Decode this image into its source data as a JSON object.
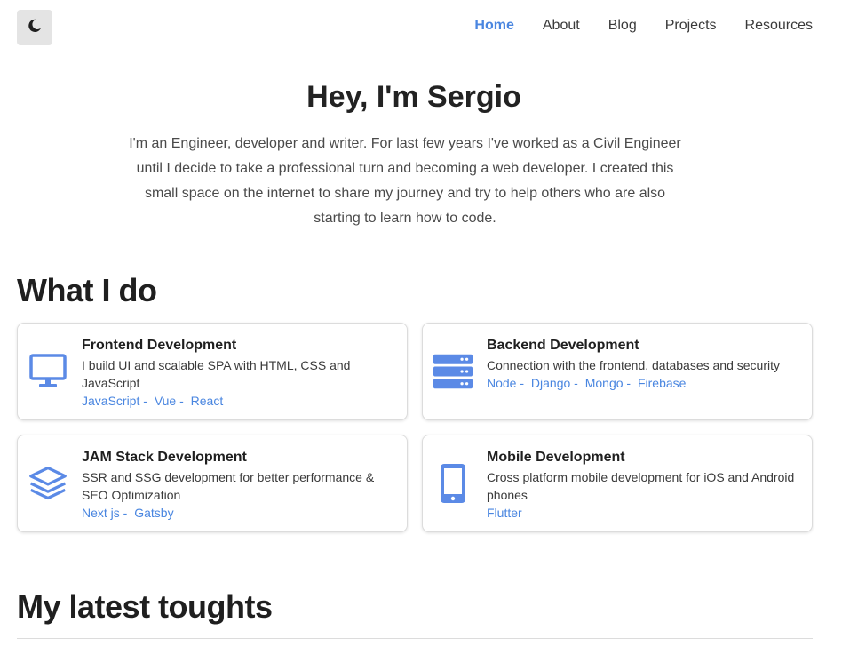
{
  "header": {
    "theme_toggle_icon": "moon-icon",
    "nav": [
      {
        "label": "Home",
        "active": true
      },
      {
        "label": "About",
        "active": false
      },
      {
        "label": "Blog",
        "active": false
      },
      {
        "label": "Projects",
        "active": false
      },
      {
        "label": "Resources",
        "active": false
      }
    ]
  },
  "hero": {
    "title": "Hey, I'm Sergio",
    "text": "I'm an Engineer, developer and writer. For last few years I've worked as a Civil Engineer until I decide to take a professional turn and becoming a web developer. I created this small space on the internet to share my journey and try to help others who are also starting to learn how to code."
  },
  "what_i_do": {
    "title": "What I do",
    "cards": [
      {
        "icon": "monitor-icon",
        "title": "Frontend Development",
        "description": "I build UI and scalable SPA with HTML, CSS and JavaScript",
        "tags": [
          "JavaScript -",
          "Vue -",
          "React"
        ]
      },
      {
        "icon": "server-icon",
        "title": "Backend Development",
        "description": "Connection with the frontend, databases and security",
        "tags": [
          "Node -",
          "Django -",
          "Mongo -",
          "Firebase"
        ]
      },
      {
        "icon": "layers-icon",
        "title": "JAM Stack Development",
        "description": "SSR and SSG development for better performance & SEO Optimization",
        "tags": [
          "Next js -",
          "Gatsby"
        ]
      },
      {
        "icon": "mobile-phone-icon",
        "title": "Mobile Development",
        "description": "Cross platform mobile development for iOS and Android phones",
        "tags": [
          "Flutter"
        ]
      }
    ]
  },
  "thoughts": {
    "title": "My latest toughts"
  },
  "colors": {
    "accent": "#4a86e0",
    "icon": "#5b8ae6"
  }
}
